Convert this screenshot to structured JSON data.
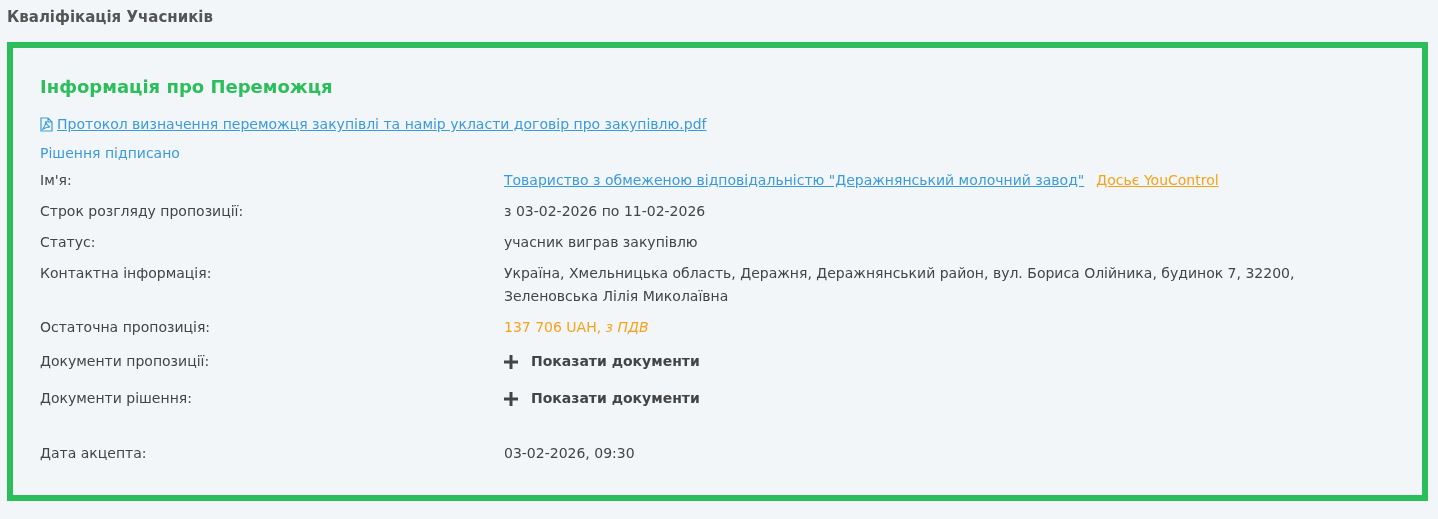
{
  "page_title": "Кваліфікація Учасників",
  "card": {
    "title": "Інформація про Переможця",
    "document_link": "Протокол визначення переможця закупівлі та намір укласти договір про закупівлю.pdf",
    "decision_status": "Рішення підписано",
    "rows": [
      {
        "kind": "company",
        "label": "Ім'я:",
        "value": "Товариство з обмеженою відповідальністю \"Деражнянський молочний завод\"",
        "extra_link": "Досьє YouControl"
      },
      {
        "kind": "text",
        "label": "Строк розгляду пропозиції:",
        "value": "з 03-02-2026 по 11-02-2026"
      },
      {
        "kind": "text",
        "label": "Статус:",
        "value": "учасник виграв закупівлю"
      },
      {
        "kind": "text",
        "label": "Контактна інформація:",
        "value": "Україна, Хмельницька область, Деражня, Деражнянський район, вул. Бориса Олійника, будинок 7, 32200,",
        "value_2": "Зеленовська Лілія Миколаївна"
      },
      {
        "kind": "price",
        "label": "Остаточна пропозиція:",
        "value": "137 706 UAH, *з ПДВ*"
      },
      {
        "kind": "docs",
        "label": "Документи пропозиції:",
        "value": "Показати документи"
      },
      {
        "kind": "docs",
        "label": "Документи рішення:",
        "value": "Показати документи"
      },
      {
        "kind": "date",
        "label": "Дата акцепта:",
        "value": "03-02-2026, 09:30"
      }
    ]
  }
}
